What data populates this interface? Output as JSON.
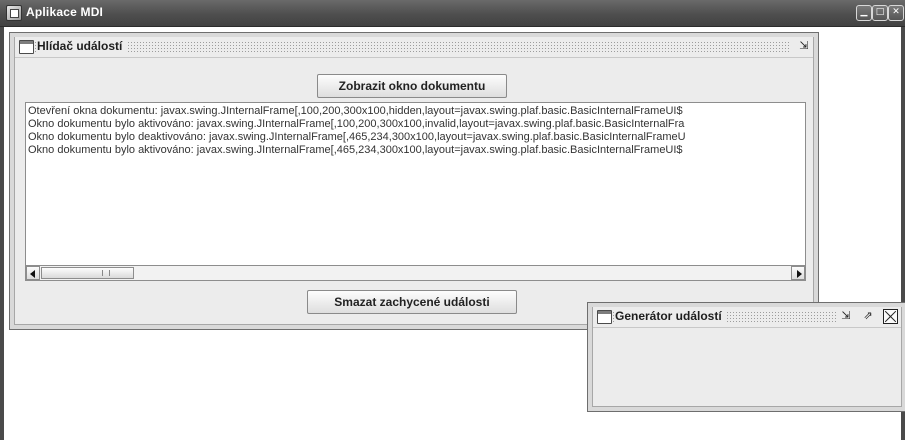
{
  "app": {
    "title": "Aplikace MDI",
    "minimize_glyph": "▁",
    "maximize_glyph": "□",
    "close_glyph": "✕"
  },
  "event_watcher": {
    "title": "Hlídač událostí",
    "show_doc_button": "Zobrazit okno dokumentu",
    "clear_button": "Smazat zachycené události",
    "restore_glyph": "⇲",
    "log_lines": [
      "Otevření okna dokumentu: javax.swing.JInternalFrame[,100,200,300x100,hidden,layout=javax.swing.plaf.basic.BasicInternalFrameUI$",
      "Okno dokumentu bylo aktivováno: javax.swing.JInternalFrame[,100,200,300x100,invalid,layout=javax.swing.plaf.basic.BasicInternalFra",
      "Okno dokumentu bylo deaktivováno: javax.swing.JInternalFrame[,465,234,300x100,layout=javax.swing.plaf.basic.BasicInternalFrameU",
      "Okno dokumentu bylo aktivováno: javax.swing.JInternalFrame[,465,234,300x100,layout=javax.swing.plaf.basic.BasicInternalFrameUI$"
    ]
  },
  "event_generator": {
    "title": "Generátor událostí",
    "restore_glyph": "⇲",
    "maximize_glyph": "⇗"
  }
}
